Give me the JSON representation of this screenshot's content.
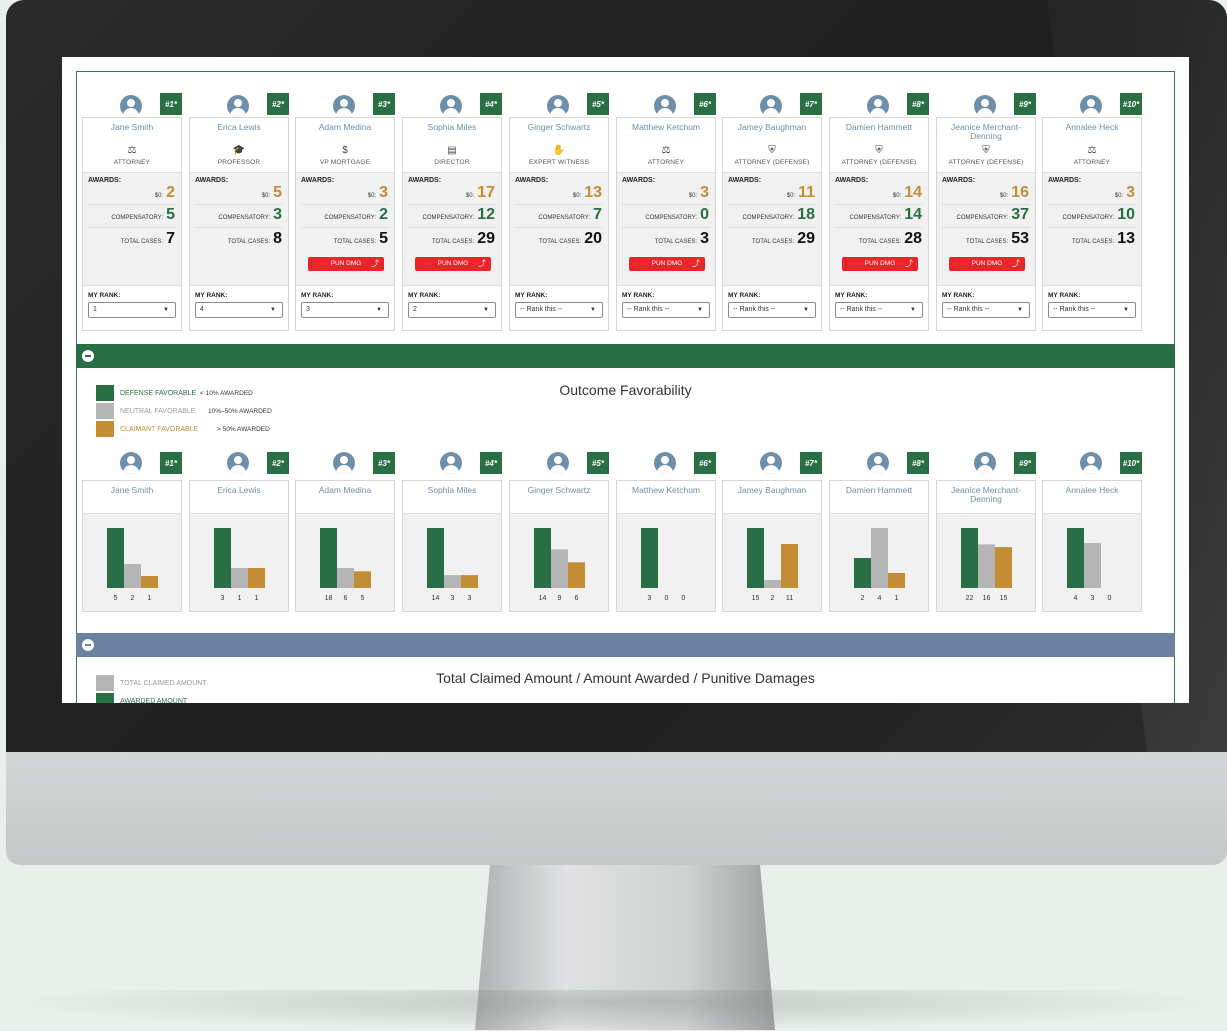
{
  "colors": {
    "defense": "#2a6e46",
    "neutral": "#b5b5b5",
    "claimant": "#c28d35",
    "pun_red": "#e8252a",
    "section_green": "#2a6e46",
    "section_slate": "#6b82a0"
  },
  "labels": {
    "awards": "AWARDS:",
    "s0": "$0:",
    "compensatory": "COMPENSATORY:",
    "total_cases": "TOTAL CASES:",
    "pun_dmg": "PUN DMG",
    "pun_arrow": "⤴",
    "my_rank": "MY RANK:",
    "caret": "▼"
  },
  "jurors": [
    {
      "badge": "#1*",
      "name": "Jane Smith",
      "role_icon": "scale-icon",
      "role_glyph": "⚖",
      "role": "ATTORNEY",
      "s0": "2",
      "s0_color": "gold",
      "comp": "5",
      "comp_color": "green",
      "total": "7",
      "pun": false,
      "rank": "1",
      "fav_label": "Jane Smith"
    },
    {
      "badge": "#2*",
      "name": "Erica Lewis",
      "role_icon": "graduation-cap-icon",
      "role_glyph": "🎓",
      "role": "PROFESSOR",
      "s0": "5",
      "s0_color": "gold",
      "comp": "3",
      "comp_color": "green",
      "total": "8",
      "pun": false,
      "rank": "4",
      "fav_label": "Erica Lewis"
    },
    {
      "badge": "#3*",
      "name": "Adam Medina",
      "role_icon": "dollar-icon",
      "role_glyph": "$",
      "role": "VP MORTGAGE",
      "s0": "3",
      "s0_color": "gold",
      "comp": "2",
      "comp_color": "green",
      "total": "5",
      "pun": true,
      "rank": "3",
      "fav_label": "Adam Medina"
    },
    {
      "badge": "#4*",
      "name": "Sophia Miles",
      "role_icon": "building-icon",
      "role_glyph": "▤",
      "role": "DIRECTOR",
      "s0": "17",
      "s0_color": "gold",
      "comp": "12",
      "comp_color": "green",
      "total": "29",
      "pun": true,
      "rank": "2",
      "fav_label": "Sophia Miles"
    },
    {
      "badge": "#5*",
      "name": "Ginger Schwartz",
      "role_icon": "hand-icon",
      "role_glyph": "✋",
      "role": "EXPERT WITNESS",
      "s0": "13",
      "s0_color": "gold",
      "comp": "7",
      "comp_color": "green",
      "total": "20",
      "pun": false,
      "rank": "-- Rank this --",
      "fav_label": "Ginger Schwartz"
    },
    {
      "badge": "#6*",
      "name": "Matthew Ketchum",
      "role_icon": "scale-icon",
      "role_glyph": "⚖",
      "role": "ATTORNEY",
      "s0": "3",
      "s0_color": "gold",
      "comp": "0",
      "comp_color": "green",
      "total": "3",
      "pun": true,
      "rank": "-- Rank this --",
      "fav_label": "Matthew Ketchum"
    },
    {
      "badge": "#7*",
      "name": "Jamey Baughman",
      "role_icon": "shield-icon",
      "role_glyph": "⛨",
      "role": "ATTORNEY (DEFENSE)",
      "s0": "11",
      "s0_color": "gold",
      "comp": "18",
      "comp_color": "green",
      "total": "29",
      "pun": false,
      "rank": "-- Rank this --",
      "fav_label": "Jamey Baughman"
    },
    {
      "badge": "#8*",
      "name": "Damien Hammett",
      "role_icon": "shield-icon",
      "role_glyph": "⛨",
      "role": "ATTORNEY (DEFENSE)",
      "s0": "14",
      "s0_color": "gold",
      "comp": "14",
      "comp_color": "green",
      "total": "28",
      "pun": true,
      "rank": "-- Rank this --",
      "fav_label": "Damien Hammett"
    },
    {
      "badge": "#9*",
      "name": "Jeanice Merchant-Denning",
      "role_icon": "shield-icon",
      "role_glyph": "⛨",
      "role": "ATTORNEY (DEFENSE)",
      "s0": "16",
      "s0_color": "gold",
      "comp": "37",
      "comp_color": "green",
      "total": "53",
      "pun": true,
      "rank": "-- Rank this --",
      "fav_label": "Jeanice Merchant-Denning"
    },
    {
      "badge": "#10*",
      "name": "Annalee Heck",
      "role_icon": "scale-icon",
      "role_glyph": "⚖",
      "role": "ATTORNEY",
      "s0": "3",
      "s0_color": "gold",
      "comp": "10",
      "comp_color": "green",
      "total": "13",
      "pun": false,
      "rank": "-- Rank this --",
      "fav_label": "Annalee Heck"
    }
  ],
  "favorability": {
    "title": "Outcome Favorability",
    "legend": [
      {
        "label": "DEFENSE FAVORABLE",
        "desc": "< 10% AWARDED",
        "color": "#2a6e46"
      },
      {
        "label": "NEUTRAL FAVORABLE",
        "desc": "10%–50% AWARDED",
        "color": "#b5b5b5"
      },
      {
        "label": "CLAIMANT FAVORABLE",
        "desc": "> 50% AWARDED",
        "color": "#c28d35"
      }
    ]
  },
  "chart_data": {
    "type": "bar",
    "categories": [
      "Jane Smith",
      "Erica Lewis",
      "Adam Medina",
      "Sophia Miles",
      "Ginger Schwartz",
      "Matthew Ketchum",
      "Jamey Baughman",
      "Damien Hammett",
      "Jeanice Merchant-Denning",
      "Annalee Heck"
    ],
    "series": [
      {
        "name": "DEFENSE FAVORABLE",
        "values": [
          5,
          3,
          18,
          14,
          14,
          3,
          15,
          2,
          22,
          4
        ]
      },
      {
        "name": "NEUTRAL FAVORABLE",
        "values": [
          2,
          1,
          6,
          3,
          9,
          0,
          2,
          4,
          16,
          3
        ]
      },
      {
        "name": "CLAIMANT FAVORABLE",
        "values": [
          1,
          1,
          5,
          3,
          6,
          0,
          11,
          1,
          15,
          0
        ]
      }
    ]
  },
  "amounts": {
    "title": "Total Claimed Amount / Amount Awarded / Punitive Damages",
    "legend": [
      {
        "label": "TOTAL CLAIMED AMOUNT",
        "color": "#b5b5b5"
      },
      {
        "label": "AWARDED AMOUNT",
        "color": "#2a6e46"
      }
    ]
  }
}
